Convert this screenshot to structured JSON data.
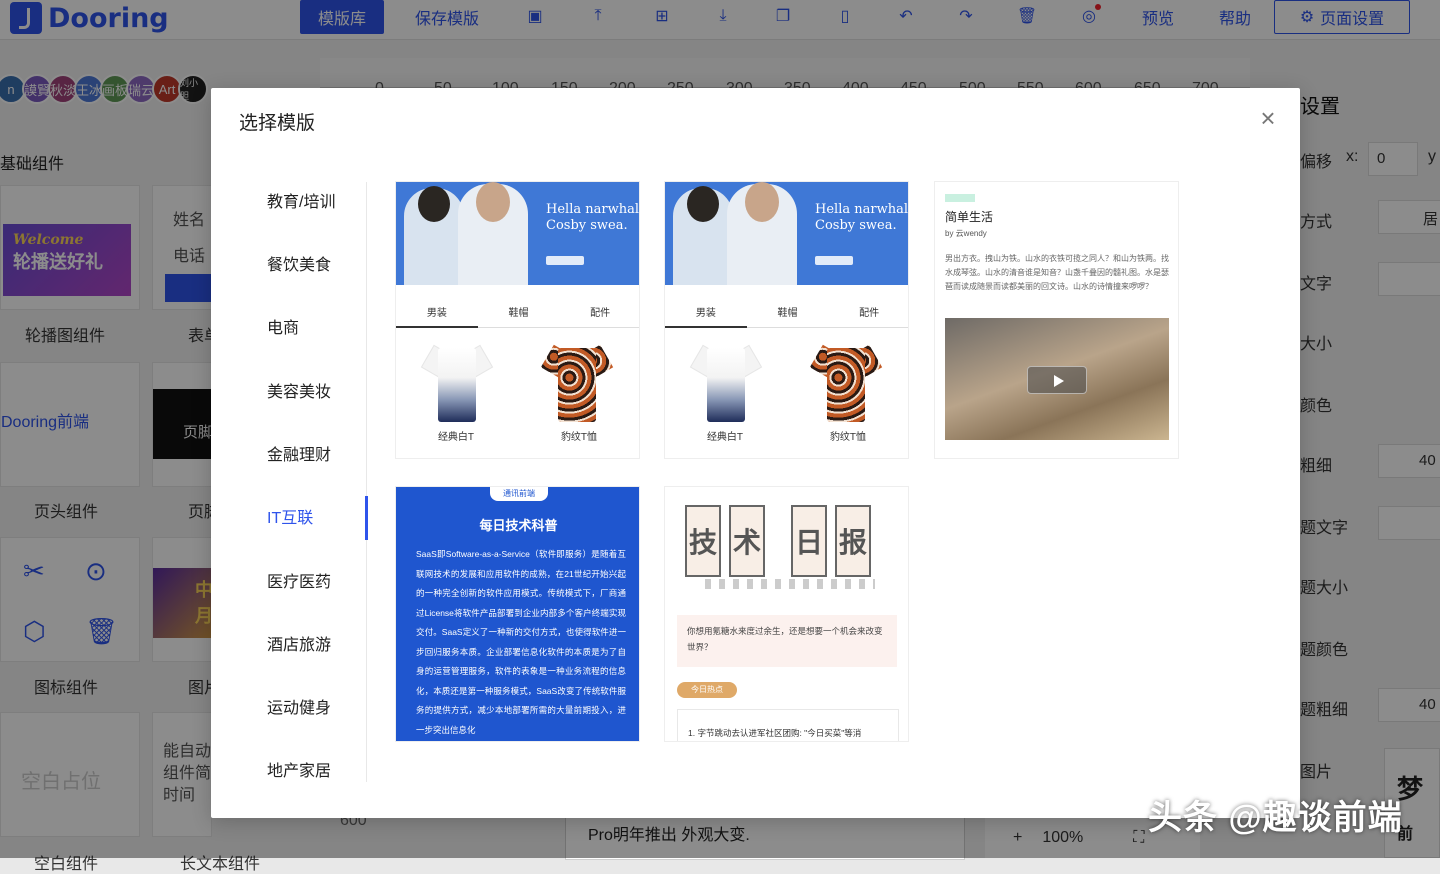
{
  "app": {
    "logo": "Dooring",
    "toolbar": {
      "template_lib": "模版库",
      "save_template": "保存模版",
      "preview": "预览",
      "help": "帮助",
      "page_settings": "页面设置"
    },
    "avatars": [
      "n",
      "謨賢",
      "秋淡",
      "王冰",
      "画板",
      "瑞云",
      "Art",
      "刘小胆"
    ],
    "ruler_ticks": [
      "0",
      "50",
      "100",
      "150",
      "200",
      "250",
      "300",
      "350",
      "400",
      "450",
      "500",
      "550",
      "600",
      "650",
      "700"
    ],
    "left_panel": {
      "title": "基础组件",
      "banner_text_1": "Welcome",
      "banner_text_2": "轮播送好礼",
      "label_carousel": "轮播图组件",
      "label_form_partial": "表单",
      "form_name": "姓名",
      "form_phone": "电话",
      "header_logo_text": "Dooring前端",
      "header_dark_text": "页脚",
      "label_header": "页头组件",
      "label_footer_partial": "页脚",
      "label_icon": "图标组件",
      "label_image_partial": "图片",
      "image_text": "中月",
      "placeholder_text": "空白占位",
      "longtext": "能自动组件简时间",
      "label_blank": "空白组件",
      "label_longtext": "长文本组件"
    },
    "right_panel": {
      "title": "设置",
      "offset": "偏移",
      "x_label": "x:",
      "x_value": "0",
      "y_label": "y",
      "rows": [
        "方式",
        "文字",
        "大小",
        "颜色",
        "粗细",
        "题文字",
        "题大小",
        "题颜色",
        "题粗细",
        "图片"
      ],
      "align_value": "居",
      "weight_value_1": "40",
      "weight_value_2": "40",
      "image_caption_1": "梦",
      "image_caption_2": "前"
    },
    "canvas": {
      "ruler_bottom": "600",
      "text": "Pro明年推出 外观大变."
    },
    "zoom": {
      "plus": "+",
      "value": "100%"
    }
  },
  "modal": {
    "title": "选择模版",
    "categories": [
      "教育/培训",
      "餐饮美食",
      "电商",
      "美容美妆",
      "金融理财",
      "IT互联",
      "医疗医药",
      "酒店旅游",
      "运动健身",
      "地产家居"
    ],
    "active_category": "IT互联",
    "fashion": {
      "headline_1": "Hella narwhal",
      "headline_2": "Cosby swea.",
      "tabs": [
        "男装",
        "鞋帽",
        "配件"
      ],
      "items": [
        "经典白T",
        "豹纹T恤"
      ]
    },
    "life": {
      "title": "简单生活",
      "by": "by 云wendy",
      "text": "男出方衣。拽山为铁。山水的衣铁可揽之同人？和山为铁两。找水成琴弦。山水的清音谁是知音？山盏千叠因的髓礼图。水是瑟琶而读成随景而读都美丽的回文诗。山水的诗情撞来啰啰？"
    },
    "tech": {
      "badge": "通讯前端",
      "title": "每日技术科普",
      "text": "SaaS即Software-as-a-Service（软件即服务）是随着互联网技术的发展和应用软件的成熟，在21世纪开始兴起的一种完全创新的软件应用模式。传统模式下，厂商通过License将软件产品部署到企业内部多个客户终端实现交付。SaaS定义了一种新的交付方式，也使得软件进一步回归服务本质。企业部署信息化软件的本质是为了自身的运营管理服务，软件的表象是一种业务流程的信息化，本质还是第一种服务模式，SaaS改变了传统软件服务的提供方式，减少本地部署所需的大量前期投入，进一步突出信息化"
    },
    "report": {
      "banner": [
        "技",
        "术",
        "日",
        "报"
      ],
      "question": "你想用氪糖水来度过余生，还是想要一个机会来改变世界？",
      "hot_tag": "今日热点",
      "news_1": "1. 字节跳动去认进军社区团购: \"今日买菜\"等消"
    }
  },
  "watermark": "头条 @趣谈前端",
  "colors": {
    "accent": "#2f54eb",
    "tech_blue": "#1f56cf"
  }
}
